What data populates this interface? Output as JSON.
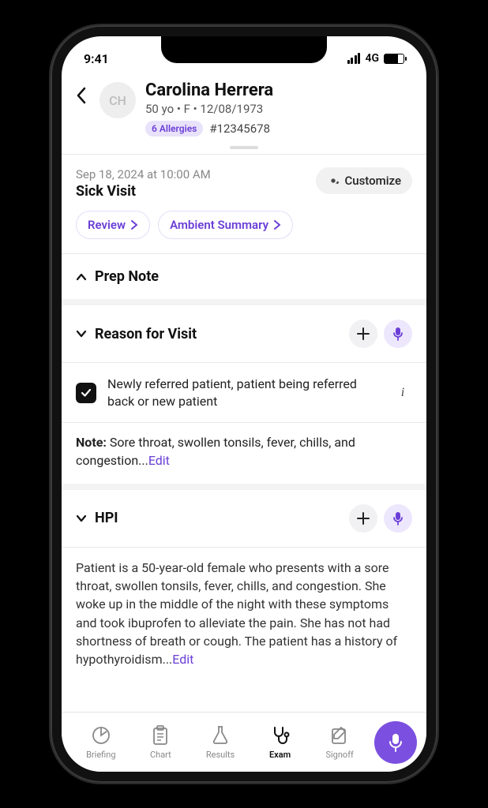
{
  "status": {
    "time": "9:41",
    "network": "4G"
  },
  "patient": {
    "initials": "CH",
    "name": "Carolina Herrera",
    "subline": "50 yo • F • 12/08/1973",
    "allergy_badge": "6 Allergies",
    "mrn": "#12345678"
  },
  "visit": {
    "datetime": "Sep 18, 2024 at 10:00 AM",
    "type": "Sick Visit",
    "customize_label": "Customize",
    "chips": {
      "review": "Review",
      "ambient": "Ambient Summary"
    }
  },
  "sections": {
    "prep_note": {
      "title": "Prep Note"
    },
    "rfv": {
      "title": "Reason for Visit",
      "item_text": "Newly referred patient, patient being referred back or new patient",
      "note_label": "Note: ",
      "note_body": "Sore throat, swollen tonsils, fever, chills, and congestion...",
      "edit": "Edit"
    },
    "hpi": {
      "title": "HPI",
      "body": "Patient is a 50-year-old female who presents with a sore throat, swollen tonsils, fever, chills, and congestion. She woke up in the middle of the night with these symptoms and took ibuprofen to alleviate the pain. She has not had shortness of breath or cough. The patient has a history of hypothyroidism...",
      "edit": "Edit"
    }
  },
  "tabs": {
    "briefing": "Briefing",
    "chart": "Chart",
    "results": "Results",
    "exam": "Exam",
    "signoff": "Signoff"
  }
}
